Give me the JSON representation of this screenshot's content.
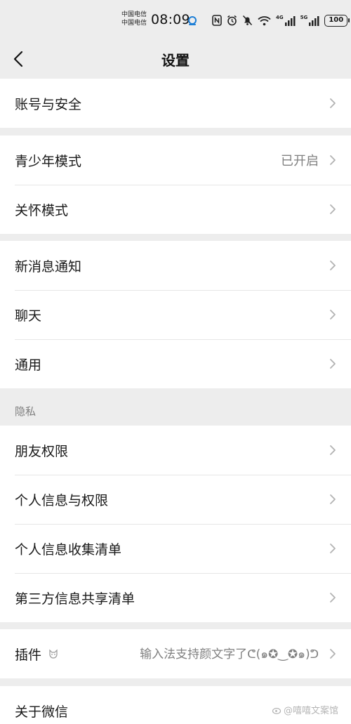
{
  "status_bar": {
    "carrier_1": "中国电信",
    "carrier_2": "中国电信",
    "time": "08:09",
    "net_4g": "4G",
    "net_5g": "5G",
    "battery": "100"
  },
  "nav": {
    "title": "设置"
  },
  "groups": {
    "account": {
      "security": "账号与安全"
    },
    "modes": {
      "teen_mode": "青少年模式",
      "teen_mode_value": "已开启",
      "care_mode": "关怀模式"
    },
    "general": {
      "notifications": "新消息通知",
      "chat": "聊天",
      "general": "通用"
    },
    "privacy": {
      "header": "隐私",
      "friends_permission": "朋友权限",
      "personal_info_permission": "个人信息与权限",
      "personal_info_list": "个人信息收集清单",
      "third_party_list": "第三方信息共享清单"
    },
    "plugins": {
      "label": "插件",
      "value": "输入法支持颜文字了ᕦ(๑✪‿✪๑)ᕤ"
    },
    "about": {
      "label": "关于微信"
    }
  },
  "watermark": "@嘻嘻文案馆",
  "colors": {
    "background": "#ededed",
    "card": "#ffffff",
    "text_primary": "#191919",
    "text_secondary": "#808080",
    "chevron": "#b2b2b2"
  }
}
